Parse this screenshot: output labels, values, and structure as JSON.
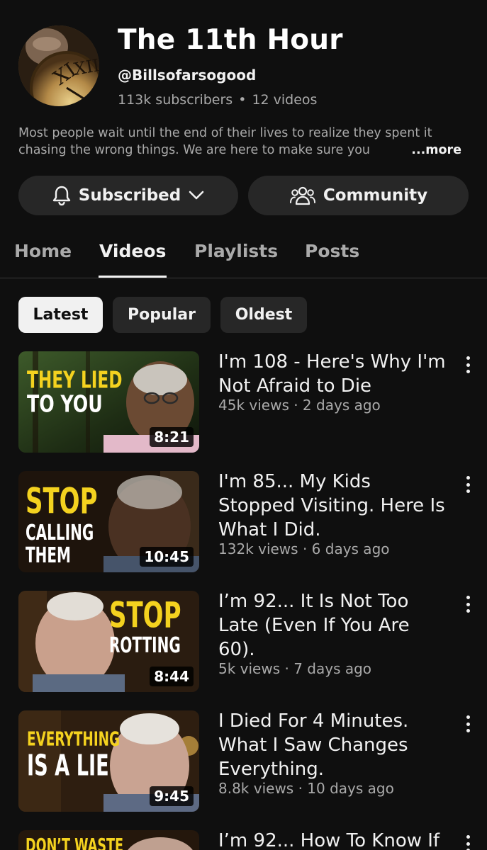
{
  "channel": {
    "title": "The 11th Hour",
    "handle": "@Billsofarsogood",
    "subscribers": "113k subscribers",
    "separator": "•",
    "video_count": "12 videos",
    "description_line1": "Most people wait until the end of their lives to realize they spent it",
    "description_line2": "chasing the wrong things. We are here to make sure you",
    "more_label": "...more"
  },
  "actions": {
    "subscribed_label": "Subscribed",
    "community_label": "Community"
  },
  "tabs": [
    {
      "label": "Home",
      "active": false
    },
    {
      "label": "Videos",
      "active": true
    },
    {
      "label": "Playlists",
      "active": false
    },
    {
      "label": "Posts",
      "active": false
    }
  ],
  "filters": [
    {
      "label": "Latest",
      "selected": true
    },
    {
      "label": "Popular",
      "selected": false
    },
    {
      "label": "Oldest",
      "selected": false
    }
  ],
  "videos": [
    {
      "title_line1": "I'm 108 - Here's Why I'm",
      "title_line2": "Not Afraid to Die",
      "title_line3": "",
      "meta": "45k views · 2 days ago",
      "duration": "8:21",
      "thumb_text1": "THEY LIED",
      "thumb_text2": "TO YOU"
    },
    {
      "title_line1": "I'm 85... My Kids",
      "title_line2": "Stopped Visiting. Here Is",
      "title_line3": "What I Did.",
      "meta": "132k views · 6 days ago",
      "duration": "10:45",
      "thumb_text1": "STOP",
      "thumb_text2": "CALLING",
      "thumb_text3": "THEM"
    },
    {
      "title_line1": "I’m 92... It Is Not Too",
      "title_line2": "Late (Even If You Are",
      "title_line3": "60).",
      "meta": "5k views · 7 days ago",
      "duration": "8:44",
      "thumb_text1": "STOP",
      "thumb_text2": "ROTTING"
    },
    {
      "title_line1": "I Died For 4 Minutes.",
      "title_line2": "What I Saw Changes",
      "title_line3": "Everything.",
      "meta": "8.8k views · 10 days ago",
      "duration": "9:45",
      "thumb_text1": "EVERYTHING",
      "thumb_text2": "IS A LIE"
    },
    {
      "title_line1": "I’m 92... How To Know If",
      "title_line2": "",
      "title_line3": "",
      "meta": "",
      "duration": "",
      "thumb_text1": "DON’T WASTE"
    }
  ],
  "icons": {
    "bell": "bell-icon",
    "chevron": "chevron-down-icon",
    "community": "community-people-icon",
    "kebab": "more-vert-icon"
  },
  "colors": {
    "background": "#0f0f0f",
    "surface": "#272727",
    "text": "#f1f1f1",
    "muted": "#aaaaaa",
    "thumb_yellow": "#f4d21f"
  }
}
